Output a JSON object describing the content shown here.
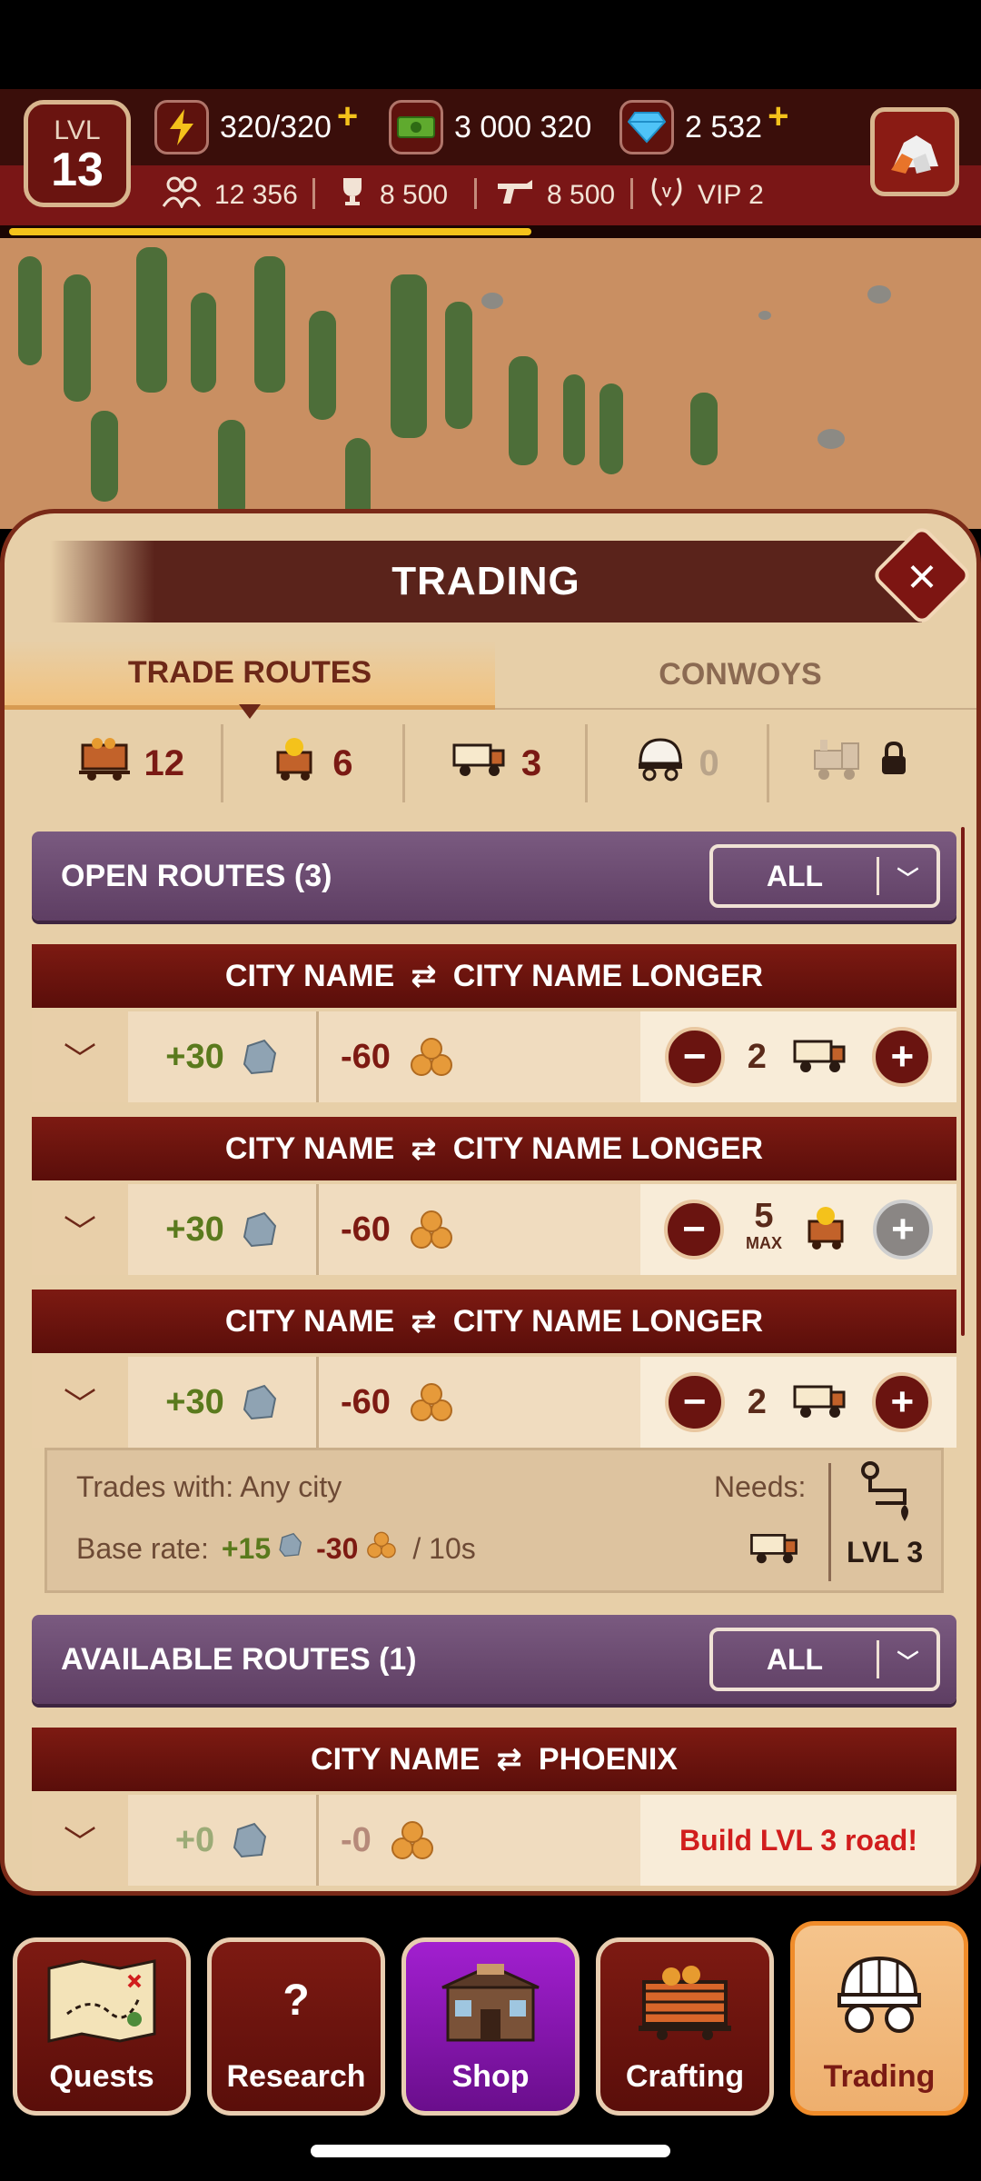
{
  "hud": {
    "level_label": "LVL",
    "level": "13",
    "energy": "320/320",
    "cash": "3 000 320",
    "gems": "2 532",
    "population": "12 356",
    "trophies": "8 500",
    "guns": "8 500",
    "vip": "VIP 2",
    "plus": "+"
  },
  "panel": {
    "title": "TRADING",
    "close": "×",
    "tabs": {
      "trade_routes": "TRADE ROUTES",
      "convoys": "CONWOYS"
    },
    "counts": {
      "mine_carts": "12",
      "ore": "6",
      "trucks": "3",
      "wagons": "0"
    }
  },
  "open_routes": {
    "heading": "OPEN ROUTES (3)",
    "filter": "ALL",
    "routes": [
      {
        "from": "CITY NAME",
        "to": "CITY NAME LONGER",
        "gain": "+30",
        "cost": "-60",
        "qty": "2",
        "max": "",
        "plus_disabled": false
      },
      {
        "from": "CITY NAME",
        "to": "CITY NAME LONGER",
        "gain": "+30",
        "cost": "-60",
        "qty": "5",
        "max": "MAX",
        "plus_disabled": true
      },
      {
        "from": "CITY NAME",
        "to": "CITY NAME LONGER",
        "gain": "+30",
        "cost": "-60",
        "qty": "2",
        "max": "",
        "plus_disabled": false
      }
    ],
    "details": {
      "trades_with": "Trades with: Any city",
      "base_rate_label": "Base rate:",
      "base_gain": "+15",
      "base_cost": "-30",
      "per_time": "/ 10s",
      "needs": "Needs:",
      "needs_level": "LVL 3"
    }
  },
  "available_routes": {
    "heading": "AVAILABLE ROUTES (1)",
    "filter": "ALL",
    "routes": [
      {
        "from": "CITY NAME",
        "to": "PHOENIX",
        "gain": "+0",
        "cost": "-0",
        "warning": "Build LVL 3 road!"
      }
    ]
  },
  "nav": {
    "quests": "Quests",
    "research": "Research",
    "research_icon": "?",
    "shop": "Shop",
    "crafting": "Crafting",
    "trading": "Trading"
  },
  "colors": {
    "hud_dark": "#3a0e0a",
    "hud_red": "#7a1616",
    "panel_bg": "#e7cfa8",
    "route_red": "#7d1a12",
    "section_purple": "#6a4a70",
    "gain_green": "#5a7a1d",
    "warn_red": "#d11d1d",
    "active_tab": "#eeaf6e"
  }
}
